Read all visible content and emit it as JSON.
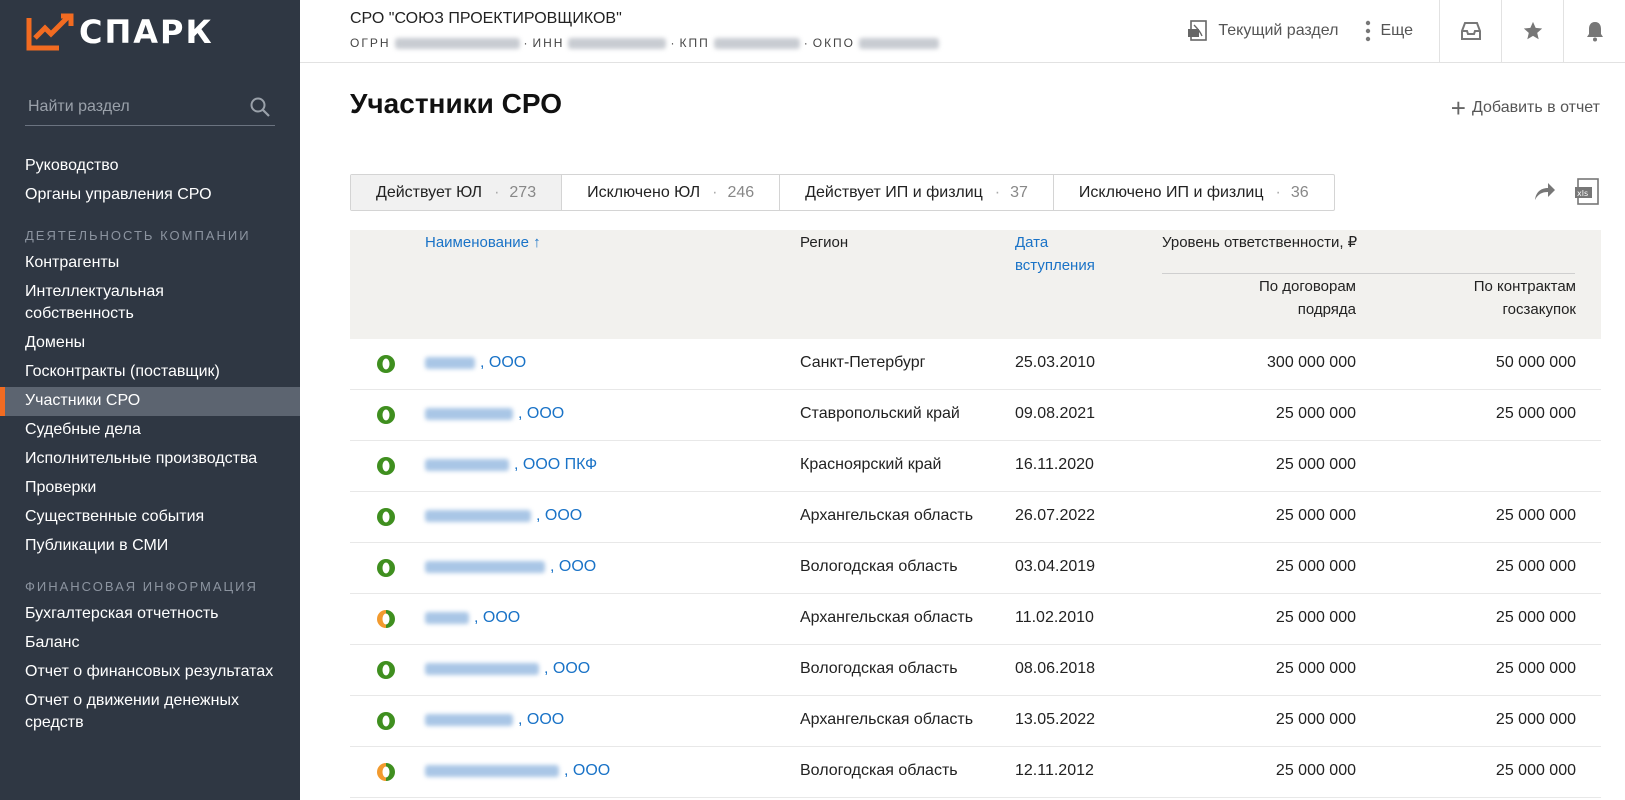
{
  "app": {
    "logo_text": "СПАРК",
    "brand_color": "#f26b21"
  },
  "sidebar": {
    "search_placeholder": "Найти раздел",
    "items_top": [
      {
        "label": "Руководство"
      },
      {
        "label": "Органы управления СРО"
      }
    ],
    "section_activity": "ДЕЯТЕЛЬНОСТЬ КОМПАНИИ",
    "items_activity": [
      {
        "label": "Контрагенты"
      },
      {
        "label": "Интеллектуальная собственность"
      },
      {
        "label": "Домены"
      },
      {
        "label": "Госконтракты (поставщик)"
      },
      {
        "label": "Участники СРО",
        "active": true
      },
      {
        "label": "Судебные дела"
      },
      {
        "label": "Исполнительные производства"
      },
      {
        "label": "Проверки"
      },
      {
        "label": "Существенные события"
      },
      {
        "label": "Публикации в СМИ"
      }
    ],
    "section_finance": "ФИНАНСОВАЯ ИНФОРМАЦИЯ",
    "items_finance": [
      {
        "label": "Бухгалтерская отчетность"
      },
      {
        "label": "Баланс"
      },
      {
        "label": "Отчет о финансовых результатах"
      },
      {
        "label": "Отчет о движении денежных средств"
      }
    ]
  },
  "header": {
    "company_name": "СРО \"СОЮЗ ПРОЕКТИРОВЩИКОВ\"",
    "id_labels": {
      "ogrn": "ОГРН",
      "inn": "ИНН",
      "kpp": "КПП",
      "okpo": "ОКПО"
    },
    "current_section": "Текущий раздел",
    "more": "Еще"
  },
  "page": {
    "title": "Участники СРО",
    "add_to_report": "Добавить в отчет"
  },
  "tabs": [
    {
      "label": "Действует ЮЛ",
      "count": "273",
      "active": true
    },
    {
      "label": "Исключено ЮЛ",
      "count": "246"
    },
    {
      "label": "Действует ИП и физлиц",
      "count": "37"
    },
    {
      "label": "Исключено ИП и физлиц",
      "count": "36"
    }
  ],
  "table": {
    "headers": {
      "name": "Наименование ↑",
      "region": "Регион",
      "date_line1": "Дата",
      "date_line2": "вступления",
      "responsibility": "Уровень ответственности, ₽",
      "c1_line1": "По договорам",
      "c1_line2": "подряда",
      "c2_line1": "По контрактам",
      "c2_line2": "госзакупок"
    },
    "rows": [
      {
        "status": "green",
        "name_suffix": ", ООО",
        "region": "Санкт-Петербург",
        "date": "25.03.2010",
        "c1": "300 000 000",
        "c2": "50 000 000"
      },
      {
        "status": "green",
        "name_suffix": ", ООО",
        "region": "Ставропольский край",
        "date": "09.08.2021",
        "c1": "25 000 000",
        "c2": "25 000 000"
      },
      {
        "status": "green",
        "name_suffix": ", ООО ПКФ",
        "region": "Красноярский край",
        "date": "16.11.2020",
        "c1": "25 000 000",
        "c2": ""
      },
      {
        "status": "green",
        "name_suffix": ", ООО",
        "region": "Архангельская область",
        "date": "26.07.2022",
        "c1": "25 000 000",
        "c2": "25 000 000"
      },
      {
        "status": "green",
        "name_suffix": ", ООО",
        "region": "Вологодская область",
        "date": "03.04.2019",
        "c1": "25 000 000",
        "c2": "25 000 000"
      },
      {
        "status": "orange",
        "name_suffix": ", ООО",
        "region": "Архангельская область",
        "date": "11.02.2010",
        "c1": "25 000 000",
        "c2": "25 000 000"
      },
      {
        "status": "green",
        "name_suffix": ", ООО",
        "region": "Вологодская область",
        "date": "08.06.2018",
        "c1": "25 000 000",
        "c2": "25 000 000"
      },
      {
        "status": "green",
        "name_suffix": ", ООО",
        "region": "Архангельская область",
        "date": "13.05.2022",
        "c1": "25 000 000",
        "c2": "25 000 000"
      },
      {
        "status": "orange",
        "name_suffix": ", ООО",
        "region": "Вологодская область",
        "date": "12.11.2012",
        "c1": "25 000 000",
        "c2": "25 000 000"
      }
    ]
  },
  "colors": {
    "sidebar_bg": "#2f3743",
    "link": "#1a73c7",
    "status_green": "#3f8f1f",
    "status_orange": "#f29a2e"
  }
}
